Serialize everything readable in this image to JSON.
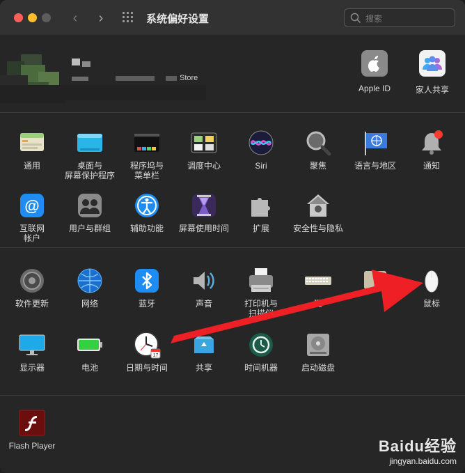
{
  "window": {
    "title": "系统偏好设置",
    "search_placeholder": "搜索"
  },
  "account": {
    "store_text": "Store",
    "items": [
      {
        "label": "Apple ID",
        "icon": "apple-icon"
      },
      {
        "label": "家人共享",
        "icon": "family-sharing-icon"
      }
    ]
  },
  "section1": [
    {
      "label": "通用",
      "icon": "general-icon"
    },
    {
      "label": "桌面与\n屏幕保护程序",
      "icon": "desktop-screensaver-icon"
    },
    {
      "label": "程序坞与\n菜单栏",
      "icon": "dock-menubar-icon"
    },
    {
      "label": "调度中心",
      "icon": "mission-control-icon"
    },
    {
      "label": "Siri",
      "icon": "siri-icon"
    },
    {
      "label": "聚焦",
      "icon": "spotlight-icon"
    },
    {
      "label": "语言与地区",
      "icon": "language-region-icon"
    },
    {
      "label": "通知",
      "icon": "notifications-icon"
    },
    {
      "label": "互联网\n帐户",
      "icon": "internet-accounts-icon"
    },
    {
      "label": "用户与群组",
      "icon": "users-groups-icon"
    },
    {
      "label": "辅助功能",
      "icon": "accessibility-icon"
    },
    {
      "label": "屏幕使用时间",
      "icon": "screen-time-icon"
    },
    {
      "label": "扩展",
      "icon": "extensions-icon"
    },
    {
      "label": "安全性与隐私",
      "icon": "security-privacy-icon"
    }
  ],
  "section2": [
    {
      "label": "软件更新",
      "icon": "software-update-icon"
    },
    {
      "label": "网络",
      "icon": "network-icon"
    },
    {
      "label": "蓝牙",
      "icon": "bluetooth-icon"
    },
    {
      "label": "声音",
      "icon": "sound-icon"
    },
    {
      "label": "打印机与\n扫描仪",
      "icon": "printers-scanners-icon"
    },
    {
      "label": "键",
      "icon": "keyboard-icon"
    },
    {
      "label": "",
      "icon": "trackpad-icon"
    },
    {
      "label": "鼠标",
      "icon": "mouse-icon"
    },
    {
      "label": "显示器",
      "icon": "displays-icon"
    },
    {
      "label": "电池",
      "icon": "battery-icon"
    },
    {
      "label": "日期与时间",
      "icon": "date-time-icon"
    },
    {
      "label": "共享",
      "icon": "sharing-icon"
    },
    {
      "label": "时间机器",
      "icon": "time-machine-icon"
    },
    {
      "label": "启动磁盘",
      "icon": "startup-disk-icon"
    }
  ],
  "section3": [
    {
      "label": "Flash Player",
      "icon": "flash-player-icon"
    }
  ],
  "watermark": {
    "logo": "Baidu经验",
    "url": "jingyan.baidu.com"
  }
}
